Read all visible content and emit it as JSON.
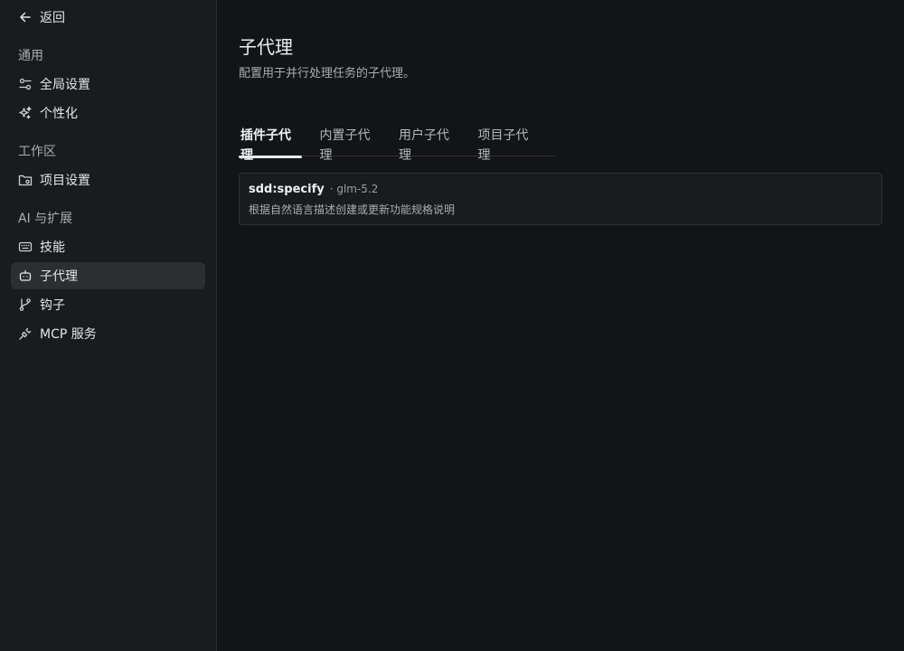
{
  "sidebar": {
    "back_label": "返回",
    "sections": [
      {
        "label": "通用",
        "items": [
          {
            "label": "全局设置",
            "icon": "sliders-icon"
          },
          {
            "label": "个性化",
            "icon": "sparkle-icon"
          }
        ]
      },
      {
        "label": "工作区",
        "items": [
          {
            "label": "项目设置",
            "icon": "folder-gear-icon"
          }
        ]
      },
      {
        "label": "AI 与扩展",
        "items": [
          {
            "label": "技能",
            "icon": "keyboard-icon"
          },
          {
            "label": "子代理",
            "icon": "robot-icon",
            "active": true
          },
          {
            "label": "钩子",
            "icon": "git-branch-icon"
          },
          {
            "label": "MCP 服务",
            "icon": "plug-icon"
          }
        ]
      }
    ]
  },
  "main": {
    "title": "子代理",
    "description": "配置用于并行处理任务的子代理。",
    "tabs": [
      {
        "label": "插件子代理",
        "active": true
      },
      {
        "label": "内置子代理"
      },
      {
        "label": "用户子代理"
      },
      {
        "label": "项目子代理"
      }
    ],
    "agents": [
      {
        "name": "sdd:specify",
        "model": "· glm-5.2",
        "description": "根据自然语言描述创建或更新功能规格说明"
      }
    ]
  },
  "colors": {
    "background": "#131416",
    "sidebar": "#1a1b1e",
    "active_item": "#2c2e32"
  }
}
